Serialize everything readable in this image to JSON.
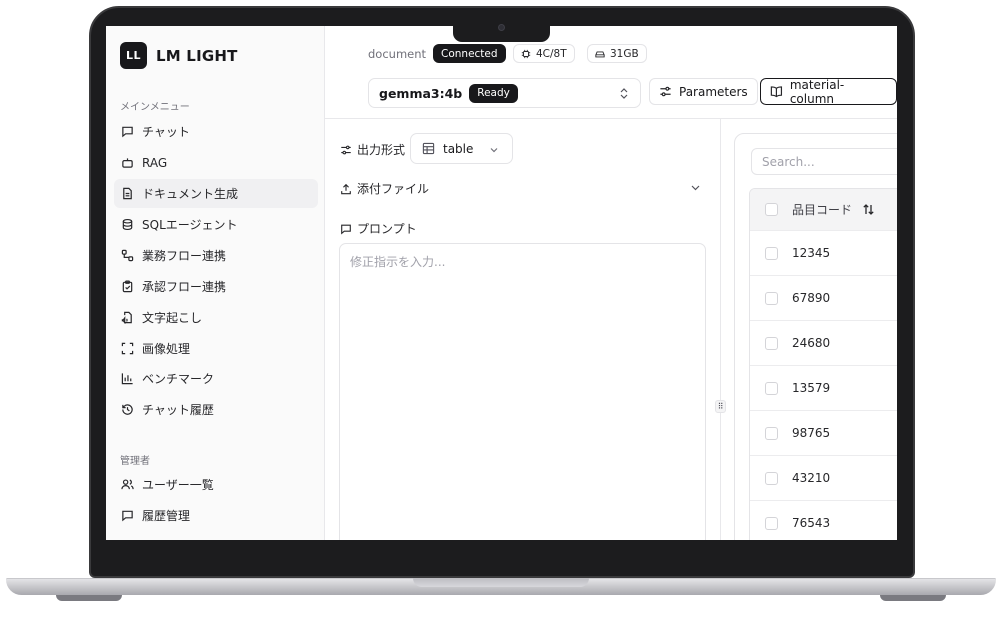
{
  "app": {
    "brand_initials": "LL",
    "brand_name": "LM LIGHT"
  },
  "sidebar": {
    "main_section": "メインメニュー",
    "items": [
      {
        "label": "チャット",
        "icon": "message-square-icon"
      },
      {
        "label": "RAG",
        "icon": "bot-icon"
      },
      {
        "label": "ドキュメント生成",
        "icon": "file-text-icon",
        "active": true
      },
      {
        "label": "SQLエージェント",
        "icon": "database-icon"
      },
      {
        "label": "業務フロー連携",
        "icon": "workflow-icon"
      },
      {
        "label": "承認フロー連携",
        "icon": "clipboard-check-icon"
      },
      {
        "label": "文字起こし",
        "icon": "file-audio-icon"
      },
      {
        "label": "画像処理",
        "icon": "scan-icon"
      },
      {
        "label": "ベンチマーク",
        "icon": "bar-chart-icon"
      },
      {
        "label": "チャット履歴",
        "icon": "history-icon"
      }
    ],
    "admin_section": "管理者",
    "admin_items": [
      {
        "label": "ユーザー一覧",
        "icon": "users-icon"
      },
      {
        "label": "履歴管理",
        "icon": "message-square-icon"
      }
    ]
  },
  "topbar": {
    "breadcrumb": "document",
    "status": "Connected",
    "cpu": "4C/8T",
    "memory": "31GB",
    "model": "gemma3:4b",
    "model_status": "Ready",
    "parameters_label": "Parameters",
    "material_label": "material-column"
  },
  "editor": {
    "output_format_label": "出力形式",
    "output_format_value": "table",
    "attachments_label": "添付ファイル",
    "prompt_label": "プロンプト",
    "prompt_placeholder": "修正指示を入力..."
  },
  "table": {
    "search_placeholder": "Search...",
    "column_header": "品目コード",
    "rows": [
      "12345",
      "67890",
      "24680",
      "13579",
      "98765",
      "43210",
      "76543"
    ]
  },
  "colors": {
    "accent": "#18181b",
    "border": "#e4e4e7",
    "muted_text": "#71717a"
  }
}
